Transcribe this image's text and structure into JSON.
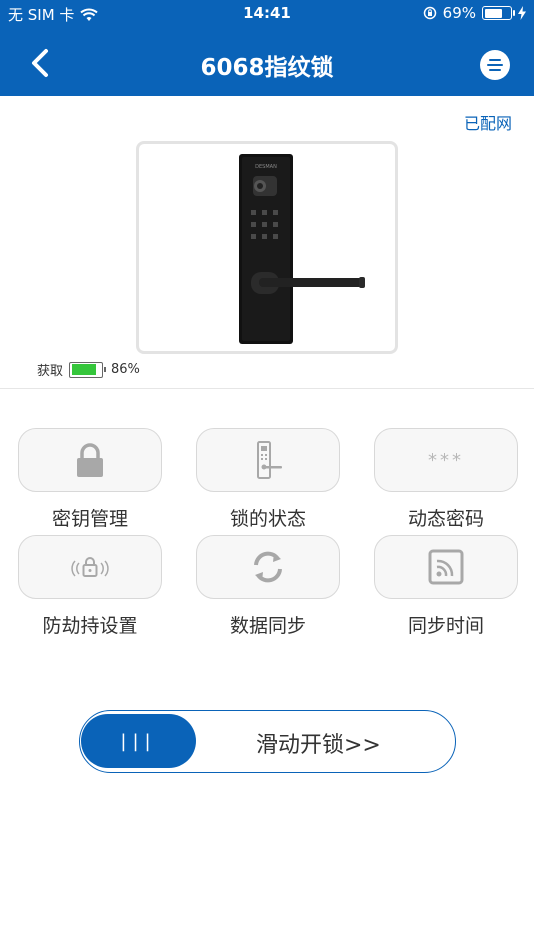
{
  "status_bar": {
    "carrier": "无 SIM 卡",
    "time": "14:41",
    "battery_pct": "69%",
    "battery_level": 0.69
  },
  "nav": {
    "title": "6068指纹锁"
  },
  "network_status": "已配网",
  "product": {
    "brand_label": "DESMAN"
  },
  "lock_battery": {
    "label": "获取",
    "percent": "86%",
    "level": 0.86,
    "color": "#35c63b"
  },
  "functions": [
    {
      "label": "密钥管理",
      "icon": "padlock-icon"
    },
    {
      "label": "锁的状态",
      "icon": "door-lock-icon"
    },
    {
      "label": "动态密码",
      "icon": "asterisks-icon",
      "icon_text": "***"
    },
    {
      "label": "防劫持设置",
      "icon": "lock-signal-icon"
    },
    {
      "label": "数据同步",
      "icon": "refresh-icon"
    },
    {
      "label": "同步时间",
      "icon": "sync-cast-icon"
    }
  ],
  "slider": {
    "knob_text": "|||",
    "label": "滑动开锁>>"
  },
  "colors": {
    "primary": "#0a63b8",
    "icon_gray": "#a8a8a8"
  }
}
